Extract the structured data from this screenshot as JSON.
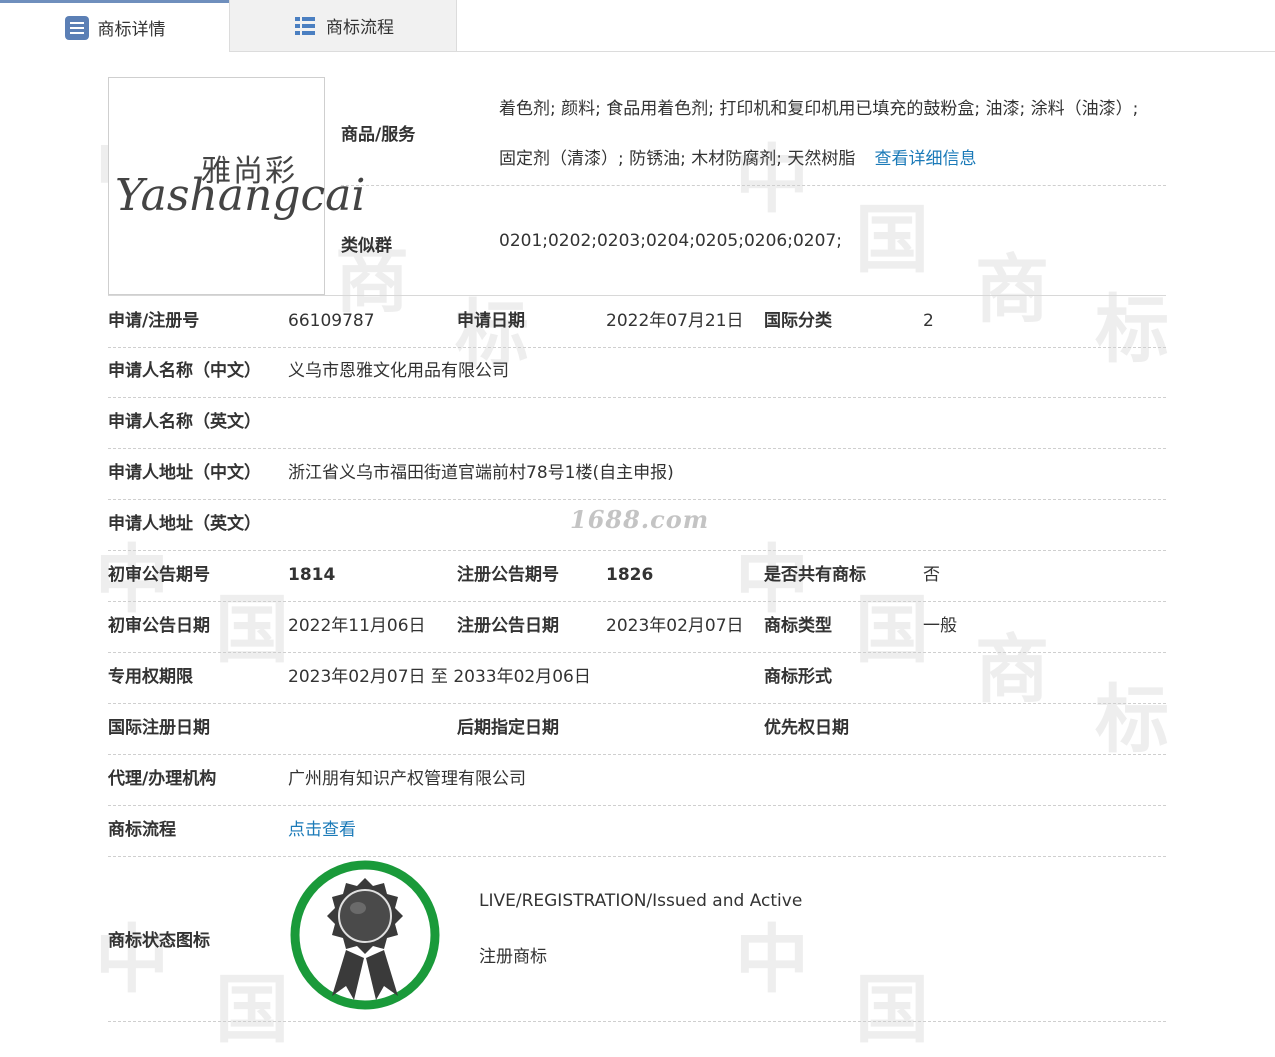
{
  "tabs": [
    {
      "label": "商标详情",
      "icon": "document-list-icon"
    },
    {
      "label": "商标流程",
      "icon": "table-list-icon"
    }
  ],
  "logo": {
    "cn": "雅尚彩",
    "en": "Yashangcai"
  },
  "goods": {
    "label": "商品/服务",
    "line1": "着色剂; 颜料; 食品用着色剂; 打印机和复印机用已填充的鼓粉盒; 油漆; 涂料（油漆）;",
    "line2": "固定剂（清漆）; 防锈油; 木材防腐剂; 天然树脂",
    "detail_link": "查看详细信息"
  },
  "similar": {
    "label": "类似群",
    "value": "0201;0202;0203;0204;0205;0206;0207;"
  },
  "fields": {
    "reg_no_label": "申请/注册号",
    "reg_no": "66109787",
    "app_date_label": "申请日期",
    "app_date": "2022年07月21日",
    "intl_class_label": "国际分类",
    "intl_class": "2",
    "applicant_cn_label": "申请人名称（中文）",
    "applicant_cn": "义乌市恩雅文化用品有限公司",
    "applicant_en_label": "申请人名称（英文）",
    "address_cn_label": "申请人地址（中文）",
    "address_cn": "浙江省义乌市福田街道官端前村78号1楼(自主申报)",
    "address_en_label": "申请人地址（英文）",
    "prelim_no_label": "初审公告期号",
    "prelim_no": "1814",
    "reg_pub_no_label": "注册公告期号",
    "reg_pub_no": "1826",
    "shared_label": "是否共有商标",
    "shared": "否",
    "prelim_date_label": "初审公告日期",
    "prelim_date": "2022年11月06日",
    "reg_pub_date_label": "注册公告日期",
    "reg_pub_date": "2023年02月07日",
    "type_label": "商标类型",
    "type": "一般",
    "term_label": "专用权期限",
    "term": "2023年02月07日 至 2033年02月06日",
    "form_label": "商标形式",
    "intl_reg_date_label": "国际注册日期",
    "later_date_label": "后期指定日期",
    "priority_date_label": "优先权日期",
    "agent_label": "代理/办理机构",
    "agent": "广州朋有知识产权管理有限公司",
    "process_label": "商标流程",
    "process_link": "点击查看",
    "status_label": "商标状态图标",
    "status_en": "LIVE/REGISTRATION/Issued and Active",
    "status_cn": "注册商标"
  },
  "watermark": {
    "site": "1688.com",
    "chars": [
      "中",
      "国",
      "商",
      "标"
    ]
  },
  "colors": {
    "link": "#1b7ab8",
    "badge_ring": "#1a9a3a",
    "tab_accent": "#6f8fbd"
  }
}
